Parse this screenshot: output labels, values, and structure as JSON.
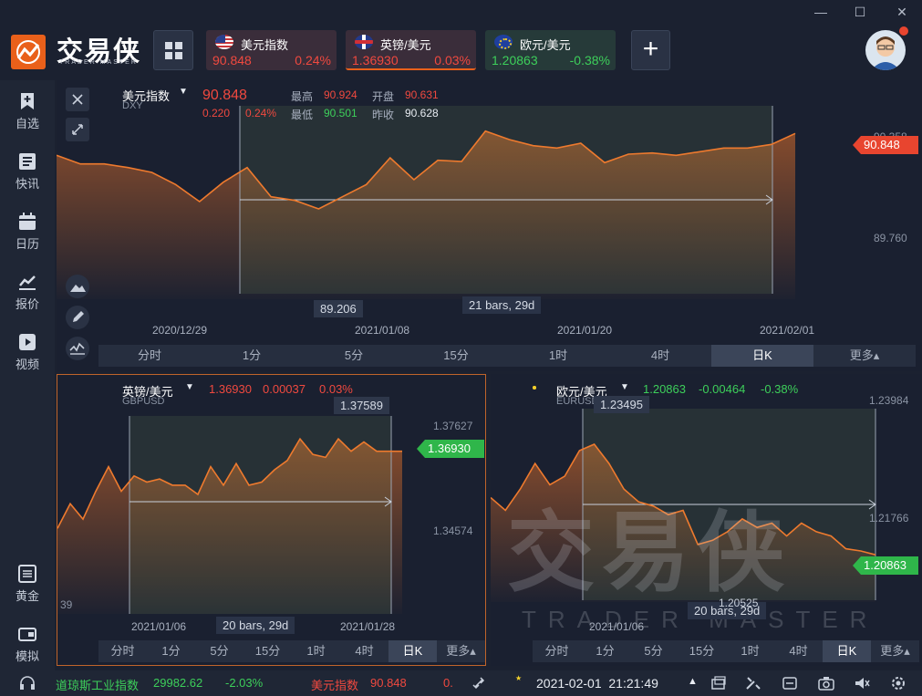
{
  "app": {
    "name": "交易侠",
    "subtitle": "TRADER MASTER"
  },
  "window_controls": [
    "—",
    "☐",
    "✕"
  ],
  "tickers": [
    {
      "name": "美元指数",
      "price": "90.848",
      "pct": "0.24%",
      "color": "#f0493f"
    },
    {
      "name": "英镑/美元",
      "price": "1.36930",
      "pct": "0.03%",
      "color": "#f0493f"
    },
    {
      "name": "欧元/美元",
      "price": "1.20863",
      "pct": "-0.38%",
      "color": "#3dcf5a"
    }
  ],
  "sidebar": {
    "top_items": [
      {
        "label": "自选",
        "icon": "bookmark-plus-icon"
      },
      {
        "label": "快讯",
        "icon": "news-list-icon"
      },
      {
        "label": "日历",
        "icon": "calendar-icon"
      },
      {
        "label": "报价",
        "icon": "line-chart-icon"
      },
      {
        "label": "视频",
        "icon": "play-video-icon"
      }
    ],
    "bottom_items": [
      {
        "label": "黄金",
        "icon": "gold-icon"
      },
      {
        "label": "模拟",
        "icon": "wallet-icon"
      }
    ]
  },
  "main_chart": {
    "symbol": "美元指数",
    "code": "DXY",
    "price": "90.848",
    "change": "0.220",
    "pct": "0.24%",
    "high_label": "最高",
    "high": "90.924",
    "open_label": "开盘",
    "open": "90.631",
    "low_label": "最低",
    "low": "90.501",
    "prev_label": "昨收",
    "prev": "90.628",
    "price_tag": "90.848",
    "axis_top": "90.358",
    "axis_mid": "89.760",
    "min_label": "89.206",
    "range_label": "21 bars, 29d",
    "dates": [
      "2020/12/29",
      "2021/01/08",
      "2021/01/20",
      "2021/02/01"
    ],
    "values": [
      90.12,
      90.05,
      90.05,
      90.02,
      89.98,
      89.88,
      89.74,
      89.9,
      90.02,
      89.78,
      89.75,
      89.68,
      89.78,
      89.88,
      90.1,
      89.92,
      90.08,
      90.07,
      90.32,
      90.25,
      90.2,
      90.18,
      90.22,
      90.06,
      90.13,
      90.14,
      90.12,
      90.15,
      90.18,
      90.18,
      90.21,
      90.3
    ]
  },
  "timeframes": [
    "分时",
    "1分",
    "5分",
    "15分",
    "1时",
    "4时",
    "日K",
    "更多▴"
  ],
  "active_timeframe": "日K",
  "gbp_chart": {
    "symbol": "英镑/美元",
    "code": "GBPUSD",
    "price": "1.36930",
    "change": "0.00037",
    "pct": "0.03%",
    "max_label": "1.37589",
    "axis_top": "1.37627",
    "axis_mid": "1.34574",
    "axis_low": "39",
    "price_tag": "1.36930",
    "range_label": "20 bars, 29d",
    "dates": [
      "2021/01/06",
      "2021/01/28"
    ],
    "values": [
      1.344,
      1.352,
      1.347,
      1.356,
      1.364,
      1.356,
      1.361,
      1.359,
      1.36,
      1.358,
      1.358,
      1.355,
      1.364,
      1.358,
      1.365,
      1.358,
      1.359,
      1.363,
      1.366,
      1.373,
      1.368,
      1.367,
      1.373,
      1.369,
      1.372,
      1.369,
      1.369,
      1.369
    ]
  },
  "eur_chart": {
    "symbol": "欧元/美元",
    "code": "EURUSD",
    "price": "1.20863",
    "change": "-0.00464",
    "pct": "-0.38%",
    "max_label": "1.23495",
    "axis_top": "1.23984",
    "axis_mid": "1.21766",
    "price_tag": "1.20863",
    "min_label": "1.20525",
    "range_label": "20 bars, 29d",
    "dates": [
      "2021/01/06"
    ],
    "values": [
      1.222,
      1.219,
      1.224,
      1.23,
      1.225,
      1.227,
      1.233,
      1.2345,
      1.23,
      1.224,
      1.221,
      1.22,
      1.218,
      1.219,
      1.211,
      1.212,
      1.214,
      1.217,
      1.215,
      1.216,
      1.213,
      1.216,
      1.214,
      1.213,
      1.21,
      1.2095,
      1.2086
    ]
  },
  "watermark": {
    "text": "交易侠",
    "sub": "TRADER MASTER"
  },
  "statusbar": {
    "index_name": "道琼斯工业指数",
    "index_value": "29982.62",
    "index_pct": "-2.03%",
    "dxy_name": "美元指数",
    "dxy_value": "90.848",
    "dxy_cut": "0.",
    "datetime": "2021-02-01  21:21:49"
  }
}
